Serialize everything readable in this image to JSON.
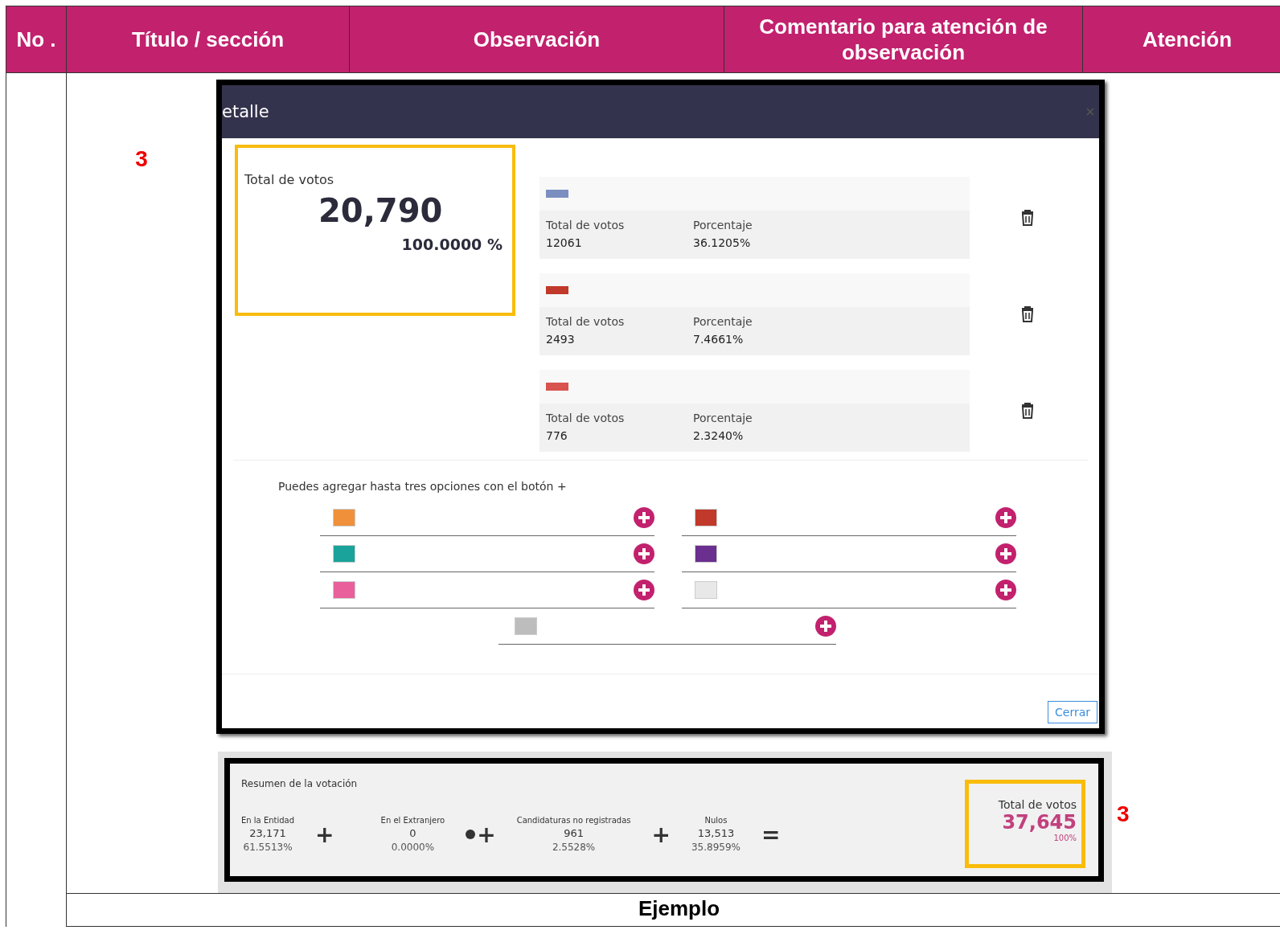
{
  "table": {
    "columns": [
      "No .",
      "Título / sección",
      "Observación",
      "Comentario para atención de observación",
      "Atención"
    ],
    "markers": [
      "3",
      "3"
    ],
    "footer_label": "Ejemplo"
  },
  "dialog": {
    "title": "etalle",
    "total": {
      "label": "Total de votos",
      "value": "20,790",
      "percent": "100.0000 %"
    },
    "parties": [
      {
        "color": "#7a8fc0",
        "votes_label": "Total de votos",
        "votes": "12061",
        "pct_label": "Porcentaje",
        "pct": "36.1205%"
      },
      {
        "color": "#c0392b",
        "votes_label": "Total de votos",
        "votes": "2493",
        "pct_label": "Porcentaje",
        "pct": "7.4661%"
      },
      {
        "color": "#d9534f",
        "votes_label": "Total de votos",
        "votes": "776",
        "pct_label": "Porcentaje",
        "pct": "2.3240%"
      }
    ],
    "hint": "Puedes agregar hasta tres opciones con el botón +",
    "options": [
      {
        "color": "#f0903a"
      },
      {
        "color": "#c0392b"
      },
      {
        "color": "#1aa39a"
      },
      {
        "color": "#6b2f8f"
      },
      {
        "color": "#e95f9c"
      },
      {
        "color": "#e8e8e8"
      },
      {
        "color": "#bdbdbd"
      }
    ],
    "close_button": "Cerrar"
  },
  "summary": {
    "title": "Resumen de la votación",
    "items": [
      {
        "label": "En la Entidad",
        "value": "23,171",
        "pct": "61.5513%",
        "op": "+",
        "info": false
      },
      {
        "label": "En el Extranjero",
        "value": "0",
        "pct": "0.0000%",
        "op": "+",
        "info": true
      },
      {
        "label": "Candidaturas no registradas",
        "value": "961",
        "pct": "2.5528%",
        "op": "+",
        "info": false
      },
      {
        "label": "Nulos",
        "value": "13,513",
        "pct": "35.8959%",
        "op": "=",
        "info": false
      }
    ],
    "total": {
      "label": "Total de votos",
      "value": "37,645",
      "percent": "100%"
    }
  }
}
